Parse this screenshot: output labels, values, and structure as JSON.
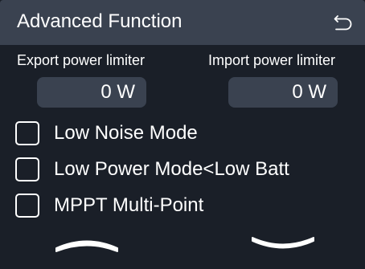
{
  "header": {
    "title": "Advanced Function",
    "back_icon": "return-arrow-icon"
  },
  "limiters": {
    "export": {
      "label": "Export power limiter",
      "value": "0 W"
    },
    "import": {
      "label": "Import power limiter",
      "value": "0 W"
    }
  },
  "options": [
    {
      "label": "Low Noise Mode",
      "checked": false
    },
    {
      "label": "Low Power Mode<Low Batt",
      "checked": false
    },
    {
      "label": "MPPT Multi-Point",
      "checked": false
    }
  ],
  "navigation": {
    "up_icon": "chevron-up-icon",
    "down_icon": "chevron-down-icon"
  },
  "colors": {
    "background": "#1a1f28",
    "panel": "#3a4250",
    "text": "#ffffff"
  }
}
